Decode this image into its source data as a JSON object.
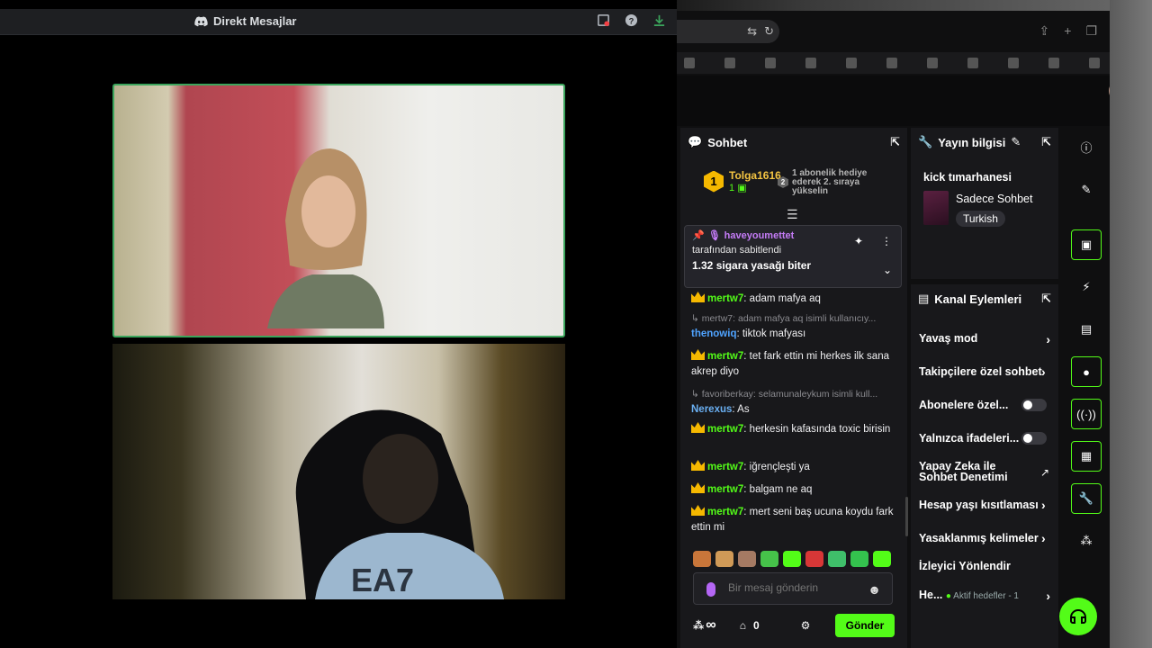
{
  "discord": {
    "title": "Direkt Mesajlar"
  },
  "chat": {
    "header": "Sohbet",
    "leader": {
      "rank": "1",
      "name": "Tolga1616",
      "gifts": "1"
    },
    "rank_info": {
      "rank": "2",
      "text": "1 abonelik hediye ederek 2. sıraya yükselin"
    },
    "pinned": {
      "user": "haveyoumettet",
      "by": "tarafından sabitlendi",
      "message": "1.32 sigara yasağı biter"
    },
    "messages": [
      {
        "user": "mertw7",
        "text": ": adam mafya aq"
      },
      {
        "reply": "mertw7: adam mafya aq isimli kullanıcıy...",
        "user": "thenowiq",
        "text": ": tiktok mafyası"
      },
      {
        "user": "mertw7",
        "text": ": tet fark ettin mi herkes ilk sana akrep diyo"
      },
      {
        "reply": "favoriberkay: selamunaleykum isimli kull...",
        "user": "Nerexus",
        "text": ": As"
      },
      {
        "user": "mertw7",
        "text": ": herkesin kafasında toxic birisin"
      },
      {
        "user": "mertw7",
        "text": ": iğrençleşti ya"
      },
      {
        "user": "mertw7",
        "text": ": balgam ne aq"
      },
      {
        "user": "mertw7",
        "text": ": mert seni baş ucuna koydu fark ettin mi"
      }
    ],
    "input_placeholder": "Bir mesaj gönderin",
    "infinity": "∞",
    "store_count": "0",
    "send_label": "Gönder"
  },
  "stream_info": {
    "header": "Yayın bilgisi",
    "title": "kick tımarhanesi",
    "category": "Sadece Sohbet",
    "language": "Turkish"
  },
  "channel_actions": {
    "header": "Kanal Eylemleri",
    "items": [
      {
        "label": "Yavaş mod"
      },
      {
        "label": "Takipçilere özel sohbet"
      },
      {
        "label": "Abonelere özel..."
      },
      {
        "label": "Yalnızca ifadeleri..."
      },
      {
        "label": "Yapay Zeka ile Sohbet Denetimi"
      },
      {
        "label": "Hesap yaşı kısıtlaması"
      },
      {
        "label": "Yasaklanmış kelimeler"
      },
      {
        "label": "İzleyici Yönlendir"
      },
      {
        "label": "He...",
        "sub": "Aktif hedefler - 1"
      }
    ]
  },
  "colors": {
    "kick_green": "#53fc18",
    "discord_green": "#3ba55c",
    "panel": "#18181b"
  }
}
